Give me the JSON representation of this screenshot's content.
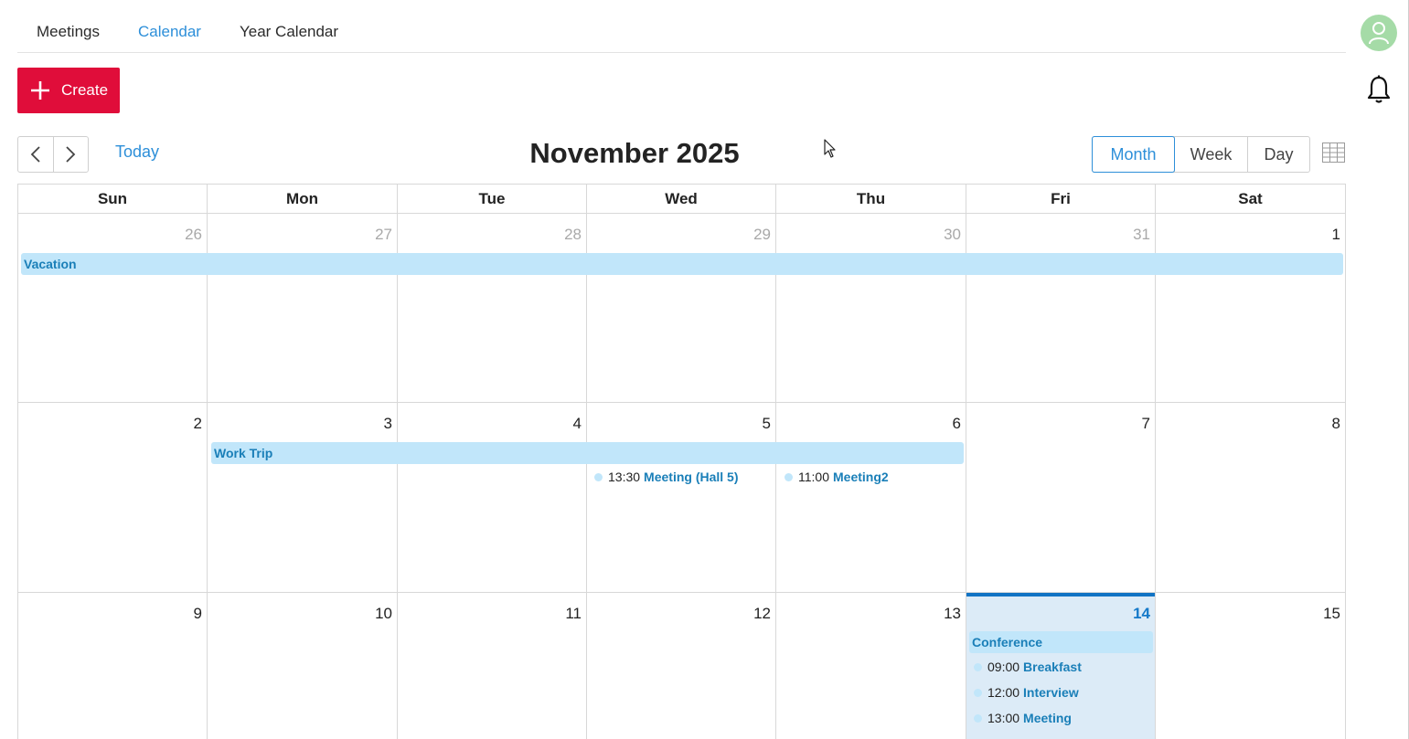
{
  "tabs": [
    {
      "label": "Meetings",
      "active": false
    },
    {
      "label": "Calendar",
      "active": true
    },
    {
      "label": "Year Calendar",
      "active": false
    }
  ],
  "create_label": "Create",
  "toolbar": {
    "today_label": "Today",
    "title": "November 2025",
    "views": [
      {
        "label": "Month",
        "active": true
      },
      {
        "label": "Week",
        "active": false
      },
      {
        "label": "Day",
        "active": false
      }
    ]
  },
  "calendar": {
    "weekdays": [
      "Sun",
      "Mon",
      "Tue",
      "Wed",
      "Thu",
      "Fri",
      "Sat"
    ],
    "weeks": [
      [
        {
          "d": "26",
          "other": true
        },
        {
          "d": "27",
          "other": true
        },
        {
          "d": "28",
          "other": true
        },
        {
          "d": "29",
          "other": true
        },
        {
          "d": "30",
          "other": true
        },
        {
          "d": "31",
          "other": true
        },
        {
          "d": "1"
        }
      ],
      [
        {
          "d": "2"
        },
        {
          "d": "3"
        },
        {
          "d": "4"
        },
        {
          "d": "5"
        },
        {
          "d": "6"
        },
        {
          "d": "7"
        },
        {
          "d": "8"
        }
      ],
      [
        {
          "d": "9"
        },
        {
          "d": "10"
        },
        {
          "d": "11"
        },
        {
          "d": "12"
        },
        {
          "d": "13"
        },
        {
          "d": "14",
          "today": true
        },
        {
          "d": "15"
        }
      ]
    ],
    "events": {
      "vacation": "Vacation",
      "work_trip": "Work Trip",
      "conference": "Conference",
      "meeting_hall5": {
        "time": "13:30",
        "title": "Meeting (Hall 5)"
      },
      "meeting2": {
        "time": "11:00",
        "title": "Meeting2"
      },
      "breakfast": {
        "time": "09:00",
        "title": "Breakfast"
      },
      "interview": {
        "time": "12:00",
        "title": "Interview"
      },
      "meeting": {
        "time": "13:00",
        "title": "Meeting"
      }
    }
  },
  "colors": {
    "accent": "#2d8fd9",
    "create": "#e00d3a",
    "event_bg": "#c1e6fa",
    "event_text": "#1a7fb8",
    "today_bg": "#dcebf7",
    "today_bar": "#1173c4",
    "avatar_bg": "#a5dba7"
  },
  "icons": [
    "plus-icon",
    "chevron-left-icon",
    "chevron-right-icon",
    "grid-icon",
    "user-icon",
    "bell-icon",
    "mouse-cursor-icon"
  ]
}
